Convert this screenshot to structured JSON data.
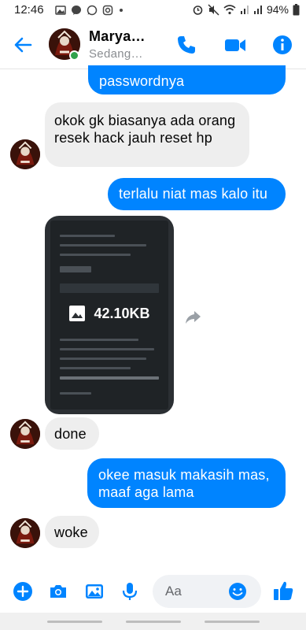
{
  "status_bar": {
    "time": "12:46",
    "battery": "94%",
    "left_icons": [
      "gallery-icon",
      "messenger-icon",
      "whatsapp-icon",
      "instagram-icon",
      "dot-icon"
    ],
    "right_icons": [
      "alarm-icon",
      "mute-icon",
      "wifi-icon",
      "signal-icon",
      "signal-icon",
      "battery-icon"
    ]
  },
  "header": {
    "contact_name": "Marya…",
    "contact_status": "Sedang…",
    "online": true
  },
  "messages": [
    {
      "direction": "outgoing",
      "text": "passwordnya"
    },
    {
      "direction": "incoming",
      "text": "okok gk biasanya ada orang resek hack jauh reset hp"
    },
    {
      "direction": "outgoing",
      "text": "terlalu niat mas kalo itu"
    },
    {
      "direction": "incoming",
      "type": "image",
      "size_label": "42.10KB"
    },
    {
      "direction": "incoming",
      "text": "done"
    },
    {
      "direction": "outgoing",
      "text": "okee masuk  makasih mas, maaf aga lama"
    },
    {
      "direction": "incoming",
      "text": "woke"
    }
  ],
  "composer": {
    "placeholder": "Aa"
  },
  "colors": {
    "accent": "#0084ff",
    "incoming_bubble": "#eeeeee",
    "online": "#31a24c"
  }
}
